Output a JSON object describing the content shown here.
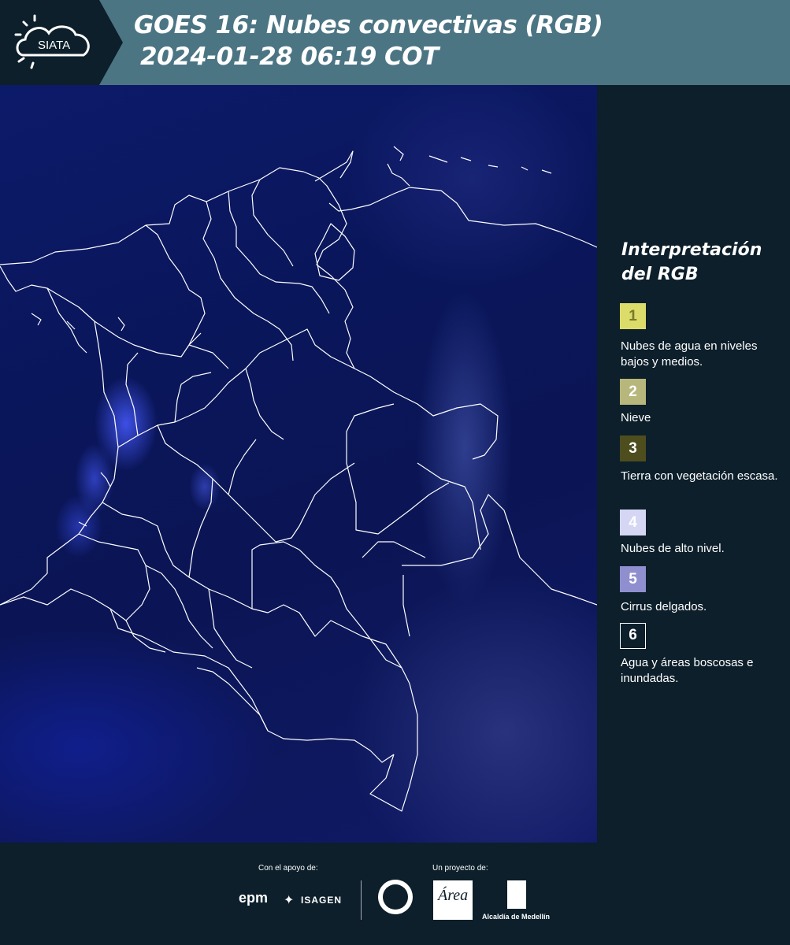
{
  "header": {
    "logo_text": "SIATA",
    "title_line1": "GOES 16: Nubes convectivas (RGB)",
    "title_line2": "2024-01-28 06:19 COT"
  },
  "legend": {
    "title": "Interpretación del RGB",
    "items": [
      {
        "num": "1",
        "label": "Nubes de agua en niveles bajos y medios.",
        "color": "#dcdc6a",
        "text_color": "#7a7a2a"
      },
      {
        "num": "2",
        "label": "Nieve",
        "color": "#b7b77c",
        "text_color": "#ffffff"
      },
      {
        "num": "3",
        "label": "Tierra con vegetación escasa.",
        "color": "#4d4d1e",
        "text_color": "#ffffff"
      },
      {
        "num": "4",
        "label": "Nubes de alto nivel.",
        "color": "#d4d6f4",
        "text_color": "#ffffff"
      },
      {
        "num": "5",
        "label": "Cirrus delgados.",
        "color": "#8f8fd0",
        "text_color": "#ffffff"
      },
      {
        "num": "6",
        "label": "Agua y áreas boscosas e inundadas.",
        "color": "#0c1f2b",
        "text_color": "#ffffff",
        "border": "#ffffff"
      }
    ]
  },
  "footer": {
    "support_label": "Con el apoyo de:",
    "project_label": "Un proyecto de:",
    "sponsors": [
      "epm",
      "ISAGEN"
    ],
    "partners": [
      "Área Metropolitana Valle de Aburrá",
      "Alcaldía de Medellín"
    ],
    "alcaldia_label": "Alcaldía de Medellín"
  }
}
